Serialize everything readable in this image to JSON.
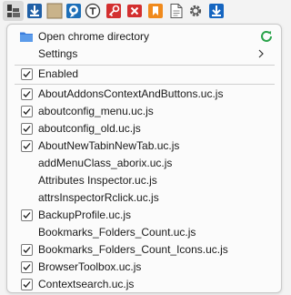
{
  "menu": {
    "open_dir_label": "Open chrome directory",
    "settings_label": "Settings",
    "enabled_label": "Enabled",
    "scripts": [
      {
        "label": "AboutAddonsContextAndButtons.uc.js",
        "checked": true
      },
      {
        "label": "aboutconfig_menu.uc.js",
        "checked": true
      },
      {
        "label": "aboutconfig_old.uc.js",
        "checked": true
      },
      {
        "label": "AboutNewTabinNewTab.uc.js",
        "checked": true
      },
      {
        "label": "addMenuClass_aborix.uc.js",
        "checked": false
      },
      {
        "label": "Attributes Inspector.uc.js",
        "checked": false
      },
      {
        "label": "attrsInspectorRclick.uc.js",
        "checked": false
      },
      {
        "label": "BackupProfile.uc.js",
        "checked": true
      },
      {
        "label": "Bookmarks_Folders_Count.uc.js",
        "checked": false
      },
      {
        "label": "Bookmarks_Folders_Count_Icons.uc.js",
        "checked": true
      },
      {
        "label": "BrowserToolbox.uc.js",
        "checked": true
      },
      {
        "label": "Contextsearch.uc.js",
        "checked": true
      }
    ]
  },
  "colors": {
    "accent_green": "#2aa34a",
    "folder_blue": "#3b7ddd",
    "check_color": "#1a1a1a"
  },
  "icons": {
    "toolbar": [
      "userchrome-scripts-icon",
      "download-arrow-icon",
      "tan-square-icon",
      "chat-bubble-icon",
      "circle-t-icon",
      "red-key-icon",
      "red-close-icon",
      "orange-bookmark-icon",
      "document-icon",
      "gear-icon",
      "blue-download-icon"
    ]
  }
}
